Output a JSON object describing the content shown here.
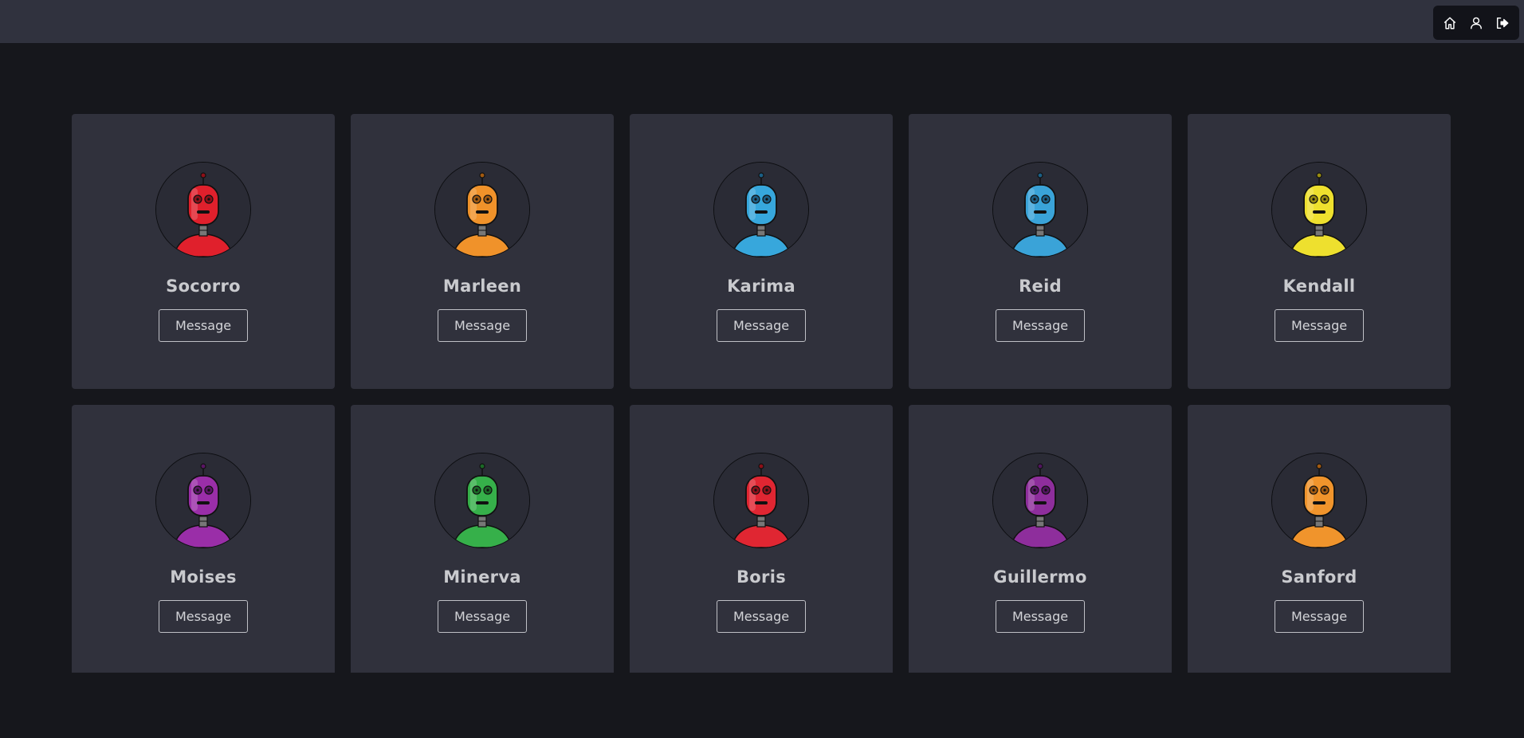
{
  "nav": {
    "items": [
      {
        "icon": "home-icon"
      },
      {
        "icon": "user-icon"
      },
      {
        "icon": "logout-icon"
      }
    ]
  },
  "colors": {
    "page_bg": "#16171c",
    "topbar_bg": "#30323e",
    "card_bg": "#30313c"
  },
  "robots": [
    {
      "name": "Socorro",
      "button": "Message",
      "color": "#e0202c",
      "dark": "#8e0f18"
    },
    {
      "name": "Marleen",
      "button": "Message",
      "color": "#f0922a",
      "dark": "#a35a10"
    },
    {
      "name": "Karima",
      "button": "Message",
      "color": "#37a7dc",
      "dark": "#1b5f86"
    },
    {
      "name": "Reid",
      "button": "Message",
      "color": "#3aa3d8",
      "dark": "#1b5f86"
    },
    {
      "name": "Kendall",
      "button": "Message",
      "color": "#eee02e",
      "dark": "#9a8d10"
    },
    {
      "name": "Moises",
      "button": "Message",
      "color": "#9a2ea8",
      "dark": "#5a1566"
    },
    {
      "name": "Minerva",
      "button": "Message",
      "color": "#36b04a",
      "dark": "#1b6a27"
    },
    {
      "name": "Boris",
      "button": "Message",
      "color": "#e02632",
      "dark": "#8e0f18"
    },
    {
      "name": "Guillermo",
      "button": "Message",
      "color": "#8e2e9c",
      "dark": "#511560"
    },
    {
      "name": "Sanford",
      "button": "Message",
      "color": "#f0942c",
      "dark": "#a35a10"
    }
  ]
}
